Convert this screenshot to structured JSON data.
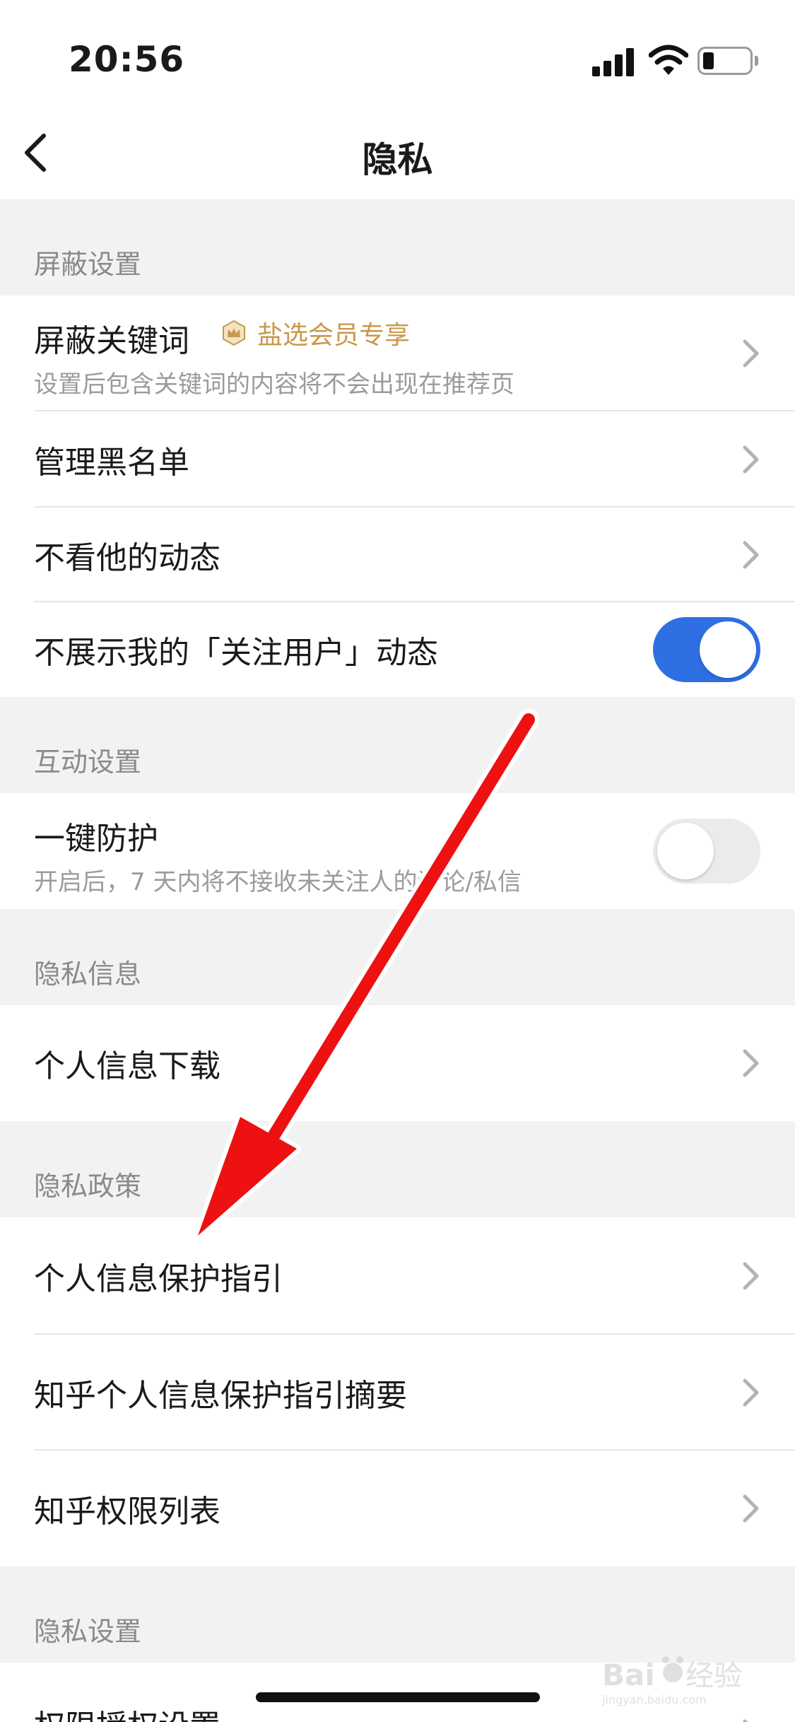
{
  "status_bar": {
    "time": "20:56"
  },
  "nav": {
    "title": "隐私"
  },
  "sections": [
    {
      "title": "屏蔽设置"
    },
    {
      "title": "互动设置"
    },
    {
      "title": "隐私信息"
    },
    {
      "title": "隐私政策"
    },
    {
      "title": "隐私设置"
    }
  ],
  "rows": {
    "block_keywords": {
      "label": "屏蔽关键词",
      "badge": "盐选会员专享",
      "subtitle": "设置后包含关键词的内容将不会出现在推荐页"
    },
    "blacklist": {
      "label": "管理黑名单"
    },
    "hide_activity": {
      "label": "不看他的动态"
    },
    "hide_following": {
      "label": "不展示我的「关注用户」动态",
      "toggle_on": true
    },
    "one_click_protect": {
      "label": "一键防护",
      "subtitle": "开启后，7 天内将不接收未关注人的评论/私信",
      "toggle_on": false
    },
    "personal_info_download": {
      "label": "个人信息下载"
    },
    "protection_guide": {
      "label": "个人信息保护指引"
    },
    "guide_summary": {
      "label": "知乎个人信息保护指引摘要"
    },
    "permission_list": {
      "label": "知乎权限列表"
    },
    "permission_settings": {
      "label": "权限授权设置"
    }
  },
  "watermark": {
    "text": "Baidu经验",
    "subtext": "jingyan.baidu.com"
  },
  "colors": {
    "accent": "#2f6fe4",
    "badge": "#c9984b",
    "annotation_arrow": "#ee1111"
  },
  "icons": {
    "back": "chevron-left-icon",
    "row_arrow": "chevron-right-icon",
    "badge": "crown-icon"
  }
}
